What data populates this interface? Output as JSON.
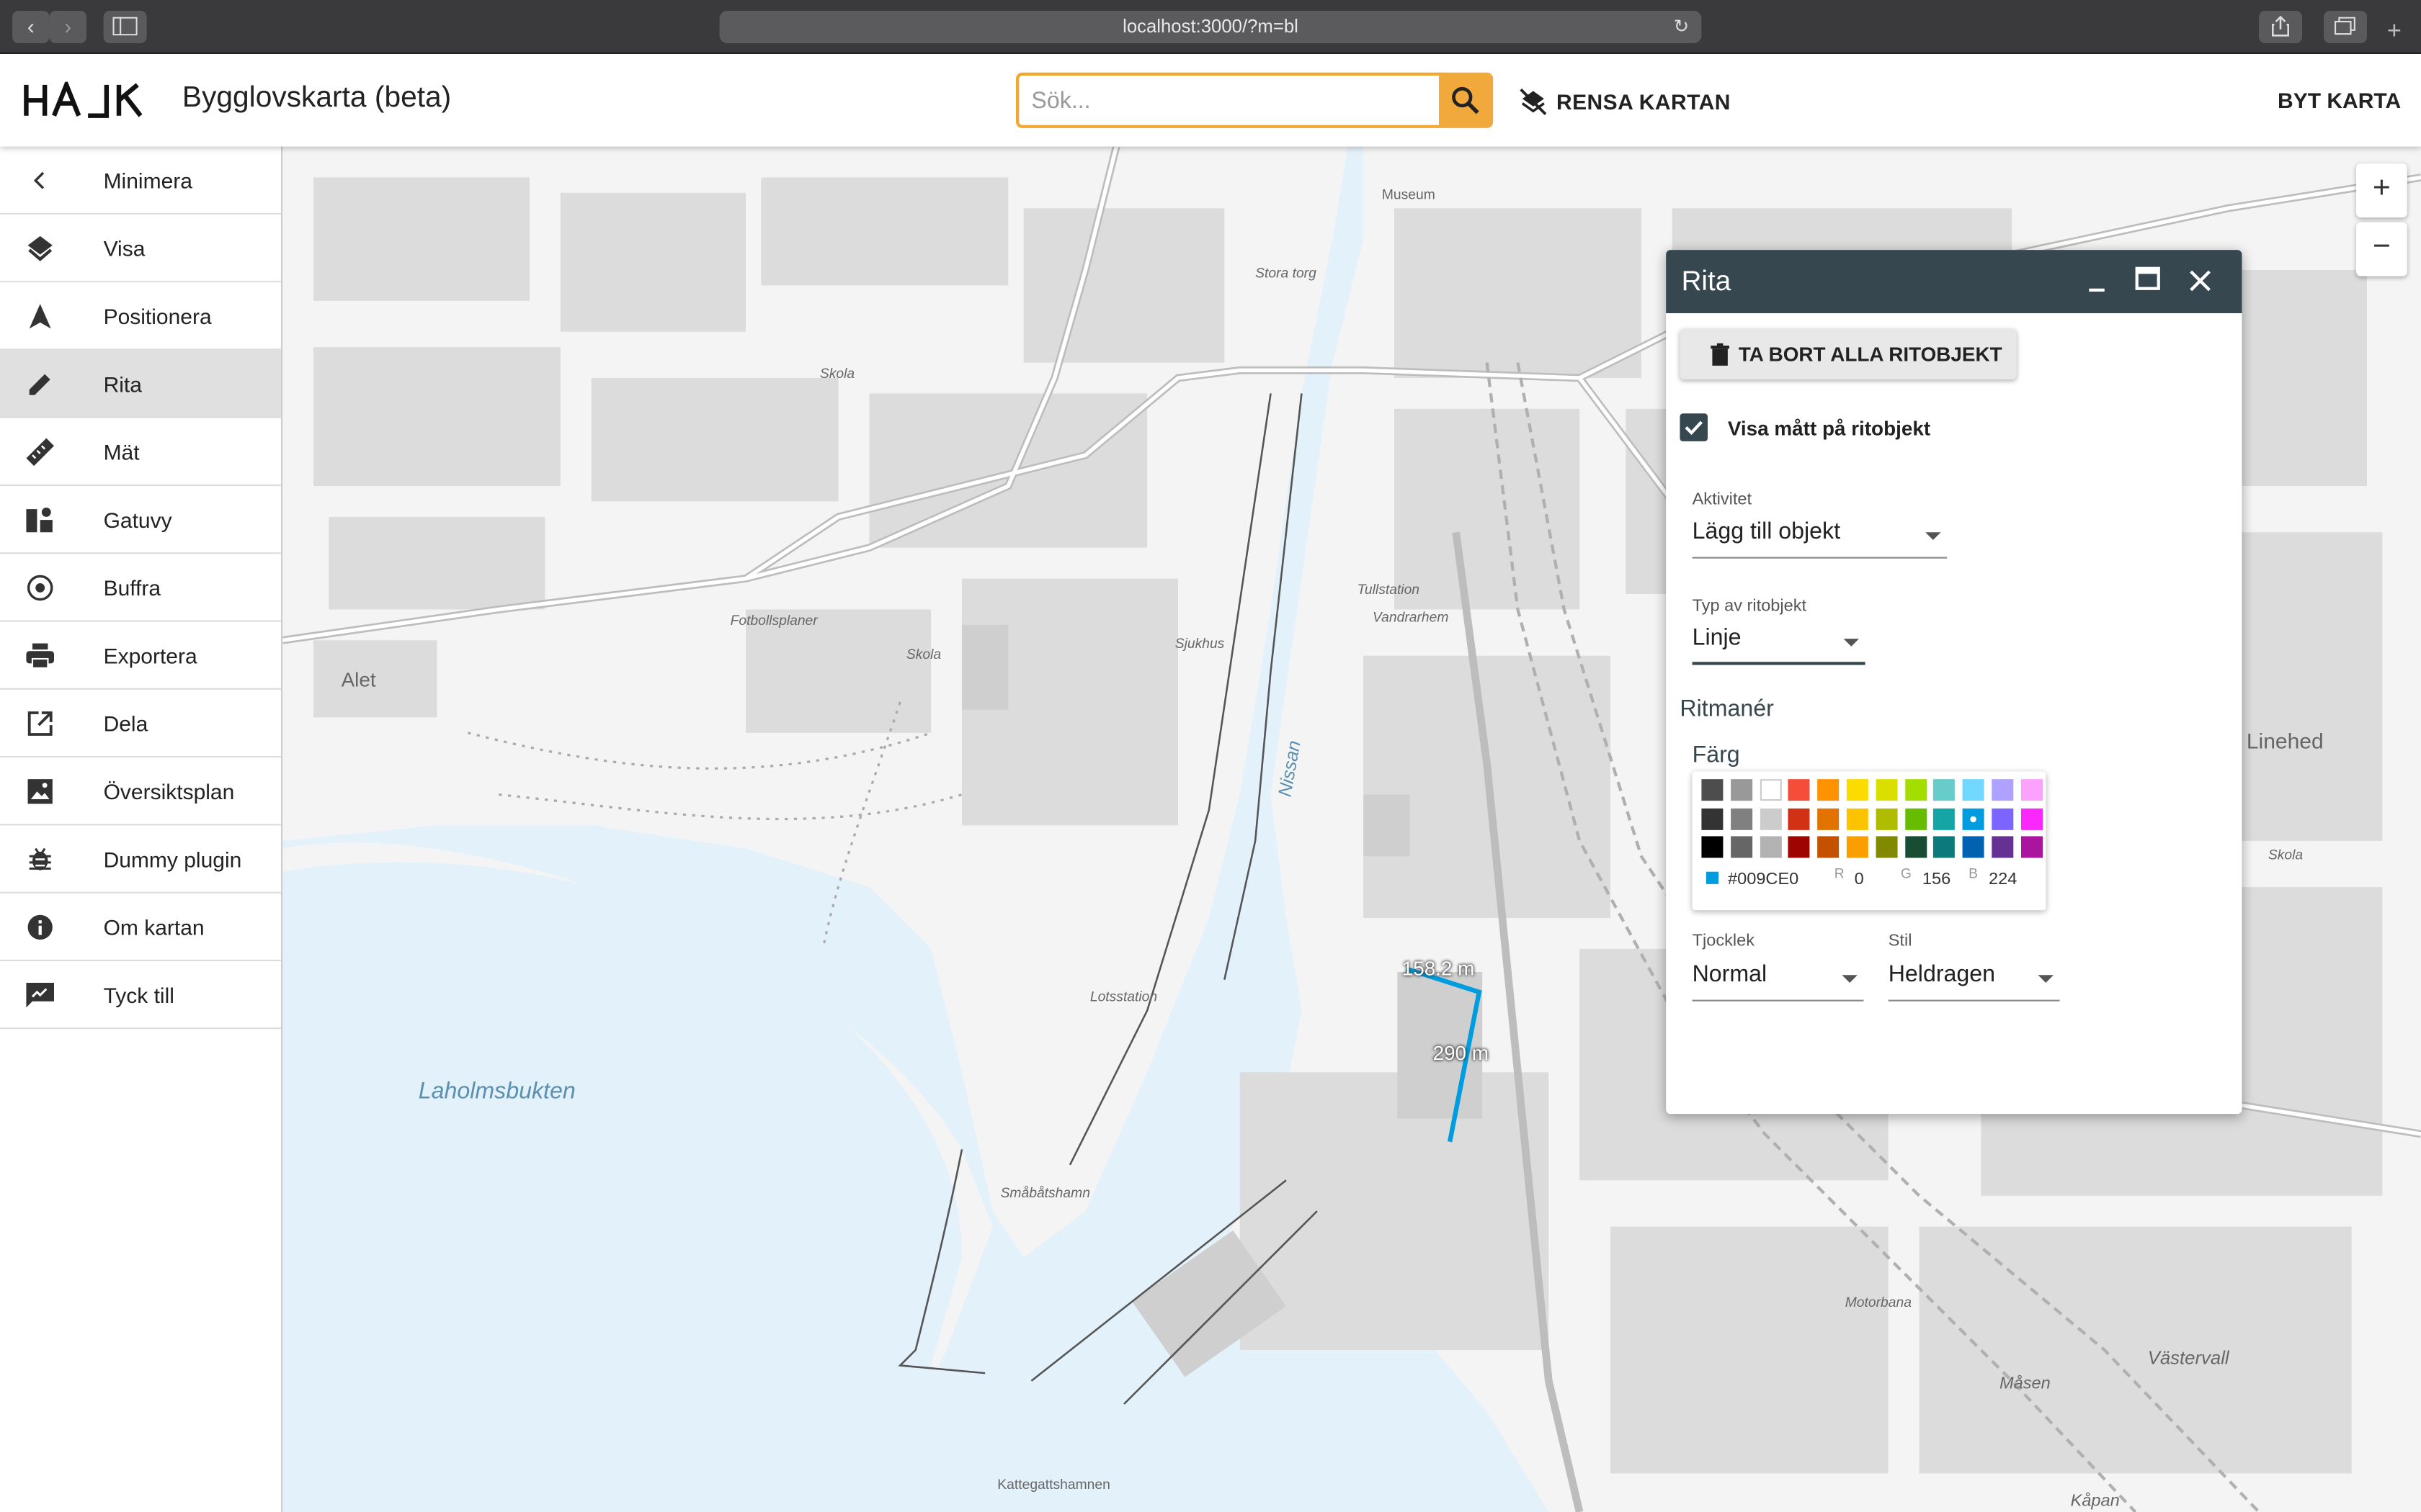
{
  "browser": {
    "url": "localhost:3000/?m=bl"
  },
  "header": {
    "title": "Bygglovskarta (beta)",
    "search_placeholder": "Sök...",
    "clear_label": "RENSA KARTAN",
    "switch_label": "BYT KARTA"
  },
  "sidebar": {
    "items": [
      {
        "label": "Minimera",
        "icon": "chevron-left-icon"
      },
      {
        "label": "Visa",
        "icon": "layers-icon"
      },
      {
        "label": "Positionera",
        "icon": "navigation-arrow-icon"
      },
      {
        "label": "Rita",
        "icon": "pencil-icon",
        "active": true
      },
      {
        "label": "Mät",
        "icon": "ruler-icon"
      },
      {
        "label": "Gatuvy",
        "icon": "street-view-icon"
      },
      {
        "label": "Buffra",
        "icon": "buffer-circle-icon"
      },
      {
        "label": "Exportera",
        "icon": "printer-icon"
      },
      {
        "label": "Dela",
        "icon": "share-external-icon"
      },
      {
        "label": "Översiktsplan",
        "icon": "image-icon"
      },
      {
        "label": "Dummy plugin",
        "icon": "bug-icon"
      },
      {
        "label": "Om kartan",
        "icon": "info-icon"
      },
      {
        "label": "Tyck till",
        "icon": "feedback-icon"
      }
    ]
  },
  "map": {
    "labels": {
      "laholmsbukten": "Laholmsbukten",
      "nissan": "Nissan",
      "alet": "Alet",
      "linehed": "Linehed",
      "fotbollsplaner": "Fotbollsplaner",
      "skola1": "Skola",
      "skola2": "Skola",
      "skola3": "Skola",
      "sjukhus": "Sjukhus",
      "tullstation": "Tullstation",
      "vandrarhem": "Vandrarhem",
      "lotsstation": "Lotsstation",
      "smabatshamn": "Småbåtshamn",
      "kattegattshamnen": "Kattegattshamnen",
      "motorbana": "Motorbana",
      "vastervall": "Västervall",
      "masen": "Måsen",
      "kapan": "Kåpan",
      "stora_torg": "Stora torg",
      "museum": "Museum"
    },
    "measure_top": "158.2 m",
    "measure_side": "290 m",
    "zoom_in": "+",
    "zoom_out": "−"
  },
  "rita": {
    "title": "Rita",
    "delete_all_label": "TA BORT ALLA RITOBJEKT",
    "show_measure_label": "Visa mått på ritobjekt",
    "show_measure_checked": true,
    "activity_label": "Aktivitet",
    "activity_value": "Lägg till objekt",
    "type_label": "Typ av ritobjekt",
    "type_value": "Linje",
    "style_section": "Ritmanér",
    "color_label": "Färg",
    "selected_hex": "#009CE0",
    "r_label": "R",
    "r_value": "0",
    "g_label": "G",
    "g_value": "156",
    "b_label": "B",
    "b_value": "224",
    "thickness_label": "Tjocklek",
    "thickness_value": "Normal",
    "stroke_style_label": "Stil",
    "stroke_style_value": "Heldragen",
    "palette": [
      [
        "#4D4D4D",
        "#999999",
        "#FFFFFF",
        "#F44E3B",
        "#FE9200",
        "#FCDC00",
        "#DBDF00",
        "#A4DD00",
        "#68CCCA",
        "#73D8FF",
        "#AEA1FF",
        "#FDA1FF"
      ],
      [
        "#333333",
        "#808080",
        "#CCCCCC",
        "#D33115",
        "#E27300",
        "#FCC400",
        "#B0BC00",
        "#68BC00",
        "#16A5A5",
        "#009CE0",
        "#7B64FF",
        "#FA28FF"
      ],
      [
        "#000000",
        "#666666",
        "#B3B3B3",
        "#9F0500",
        "#C45100",
        "#FB9E00",
        "#808900",
        "#194D33",
        "#0C797D",
        "#0062B1",
        "#653294",
        "#AB149E"
      ]
    ],
    "accent": "#009CE0"
  }
}
